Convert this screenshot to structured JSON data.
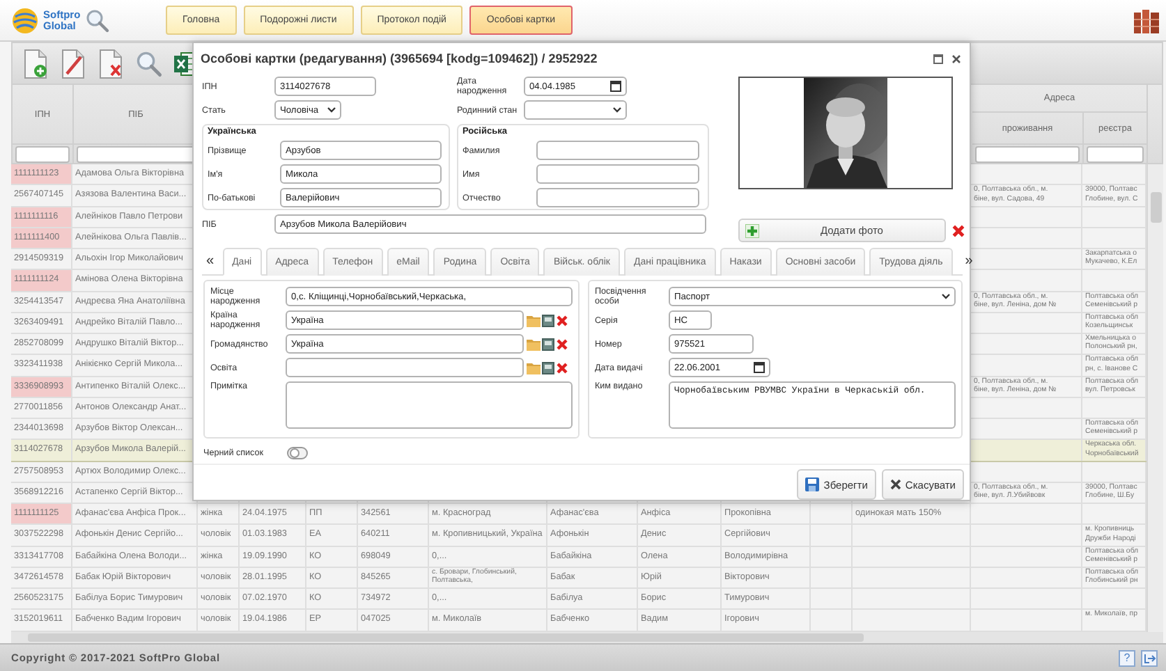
{
  "header": {
    "logo_lines": [
      "Softpro",
      "Global"
    ],
    "nav": [
      {
        "label": "Головна",
        "selected": false
      },
      {
        "label": "Подорожні листи",
        "selected": false
      },
      {
        "label": "Протокол подій",
        "selected": false
      },
      {
        "label": "Особові картки",
        "selected": true
      }
    ]
  },
  "table": {
    "group_header": "Адреса",
    "headers": {
      "ipn": "ІПН",
      "pib": "ПІБ",
      "residence": "проживання",
      "registration": "реєстра"
    },
    "rows": [
      {
        "flagged": true,
        "selected": false,
        "cells": {
          "ipn": "1111111123",
          "pib": "Адамова Ольга Вікторівна"
        }
      },
      {
        "flagged": false,
        "selected": false,
        "cells": {
          "ipn": "2567407145",
          "pib": "Азязова Валентина Васи...",
          "residence": "0, Полтавська обл., м.\nбіне, вул. Садова, 49",
          "registration": "39000, Полтавс\nГлобине, вул. С"
        }
      },
      {
        "flagged": true,
        "selected": false,
        "cells": {
          "ipn": "1111111116",
          "pib": "Алейніков Павло Петрови"
        }
      },
      {
        "flagged": true,
        "selected": false,
        "cells": {
          "ipn": "1111111400",
          "pib": "Алейнікова Ольга Павлів..."
        }
      },
      {
        "flagged": false,
        "selected": false,
        "cells": {
          "ipn": "2914509319",
          "pib": "Альохін Ігор Миколайович",
          "registration": "Закарпатська о\nМукачево, К.Ел"
        }
      },
      {
        "flagged": true,
        "selected": false,
        "cells": {
          "ipn": "1111111124",
          "pib": "Амінова Олена Вікторівна"
        }
      },
      {
        "flagged": false,
        "selected": false,
        "cells": {
          "ipn": "3254413547",
          "pib": "Андреєва Яна Анатоліївна",
          "residence": "0, Полтавська обл., м.\nбіне, вул. Леніна, дом №",
          "registration": "Полтавська обл\nСеменівський р"
        }
      },
      {
        "flagged": false,
        "selected": false,
        "cells": {
          "ipn": "3263409491",
          "pib": "Андрейко Віталій Павло...",
          "registration": "Полтавська обл\nКозельщинськ"
        }
      },
      {
        "flagged": false,
        "selected": false,
        "cells": {
          "ipn": "2852708099",
          "pib": "Андрушко Віталій Віктор...",
          "registration": "Хмельницька о\nПолонський рн,"
        }
      },
      {
        "flagged": false,
        "selected": false,
        "cells": {
          "ipn": "3323411938",
          "pib": "Анікієнко Сергій Микола...",
          "registration": "Полтавська обл\nрн, с. Іванове С"
        }
      },
      {
        "flagged": true,
        "selected": false,
        "cells": {
          "ipn": "3336908993",
          "pib": "Антипенко Віталій Олекс...",
          "residence": "0, Полтавська обл., м.\nбіне, вул. Леніна, дом №",
          "registration": "Полтавська обл\nвул. Петровськ"
        }
      },
      {
        "flagged": false,
        "selected": false,
        "cells": {
          "ipn": "2770011856",
          "pib": "Антонов Олександр Анат..."
        }
      },
      {
        "flagged": false,
        "selected": false,
        "cells": {
          "ipn": "2344013698",
          "pib": "Арзубов Віктор Олексан...",
          "registration": "Полтавська обл\nСеменівський р"
        }
      },
      {
        "flagged": false,
        "selected": true,
        "cells": {
          "ipn": "3114027678",
          "pib": "Арзубов Микола Валерій...",
          "registration": "Черкаська обл.\nЧорнобаївський"
        }
      },
      {
        "flagged": false,
        "selected": false,
        "cells": {
          "ipn": "2757508953",
          "pib": "Артюх Володимир Олекс..."
        }
      },
      {
        "flagged": false,
        "selected": false,
        "cells": {
          "ipn": "3568912216",
          "pib": "Астапенко Сергій Віктор...",
          "residence": "0, Полтавська обл., м.\nбіне, вул. Л.Убийвовк",
          "registration": "39000, Полтавс\nГлобине, Ш.Бу"
        }
      },
      {
        "flagged": true,
        "selected": false,
        "cells": {
          "ipn": "1111111125",
          "pib": "Афанас'єва Анфіса Прок...",
          "column_3": "жінка",
          "column_4": "24.04.1975",
          "column_5": "ПП",
          "column_6": "342561",
          "column_7": "м. Красноград",
          "column_8": "Афанас'єва",
          "column_9": "Анфіса",
          "column_10": "Прокопівна",
          "column_12": "одинокая мать 150%"
        }
      },
      {
        "flagged": false,
        "selected": false,
        "cells": {
          "ipn": "3037522298",
          "pib": "Афонькін Денис Сергійо...",
          "column_3": "чоловік",
          "column_4": "01.03.1983",
          "column_5": "ЕА",
          "column_6": "640211",
          "column_7": "м. Кропивницький, Україна",
          "column_8": "Афонькін",
          "column_9": "Денис",
          "column_10": "Сергійович",
          "registration": "м. Кропивниць\nДружби Народі"
        }
      },
      {
        "flagged": false,
        "selected": false,
        "cells": {
          "ipn": "3313417708",
          "pib": "Бабайкіна Олена Володи...",
          "column_3": "жінка",
          "column_4": "19.09.1990",
          "column_5": "КО",
          "column_6": "698049",
          "column_7": "0,...",
          "column_8": "Бабайкіна",
          "column_9": "Олена",
          "column_10": "Володимирівна",
          "registration": "Полтавська обл\nСеменівський р"
        }
      },
      {
        "flagged": false,
        "selected": false,
        "cells": {
          "ipn": "3472614578",
          "pib": "Бабак Юрій Вікторович",
          "column_3": "чоловік",
          "column_4": "28.01.1995",
          "column_5": "КО",
          "column_6": "845265",
          "column_7": "с. Бровари, Глобинський,\nПолтавська,",
          "column_8": "Бабак",
          "column_9": "Юрій",
          "column_10": "Вікторович",
          "registration": "Полтавська обл\nГлобинський рн"
        }
      },
      {
        "flagged": false,
        "selected": false,
        "cells": {
          "ipn": "2560523175",
          "pib": "Бабілуа Борис Тимурович",
          "column_3": "чоловік",
          "column_4": "07.02.1970",
          "column_5": "КО",
          "column_6": "734972",
          "column_7": "0,...",
          "column_8": "Бабілуа",
          "column_9": "Борис",
          "column_10": "Тимурович"
        }
      },
      {
        "flagged": false,
        "selected": false,
        "cells": {
          "ipn": "3152019611",
          "pib": "Бабченко Вадим Ігорович",
          "column_3": "чоловік",
          "column_4": "19.04.1986",
          "column_5": "ЕР",
          "column_6": "047025",
          "column_7": "м. Миколаїв",
          "column_8": "Бабченко",
          "column_9": "Вадим",
          "column_10": "Ігорович",
          "registration": "м. Миколаїв, пр"
        }
      }
    ]
  },
  "dialog": {
    "title": "Особові картки (редагування) (3965694 [kodg=109462]) / 2952922",
    "ipn": {
      "label": "ІПН",
      "value": "3114027678"
    },
    "birth_date": {
      "label": "Дата народження",
      "value": "04.04.1985"
    },
    "sex": {
      "label": "Стать",
      "value": "Чоловіча"
    },
    "marital_status": {
      "label": "Родинний стан"
    },
    "ukrainian": {
      "legend": "Українська",
      "fields": [
        {
          "label": "Прізвище",
          "value": "Арзубов"
        },
        {
          "label": "Ім'я",
          "value": "Микола"
        },
        {
          "label": "По-батькові",
          "value": "Валерійович"
        }
      ]
    },
    "russian": {
      "legend": "Російська",
      "fields": [
        {
          "label": "Фамилия"
        },
        {
          "label": "Имя"
        },
        {
          "label": "Отчество"
        }
      ]
    },
    "full_name": {
      "label": "ПІБ",
      "value": "Арзубов Микола Валерійович"
    },
    "add_photo_button": "Додати фото",
    "tabs_prev": "«",
    "tabs_next": "»",
    "tabs": [
      {
        "label": "Дані",
        "selected": true
      },
      {
        "label": "Адреса",
        "selected": false
      },
      {
        "label": "Телефон",
        "selected": false
      },
      {
        "label": "eMail",
        "selected": false
      },
      {
        "label": "Родина",
        "selected": false
      },
      {
        "label": "Освіта",
        "selected": false
      },
      {
        "label": "Військ. облік",
        "selected": false
      },
      {
        "label": "Дані працівника",
        "selected": false
      },
      {
        "label": "Накази",
        "selected": false
      },
      {
        "label": "Основні засоби",
        "selected": false
      },
      {
        "label": "Трудова діяль",
        "selected": false
      }
    ],
    "left_fields": [
      {
        "kind": "text",
        "label": "Місце народження",
        "value": "0,с. Кліщинці,Чорнобаївський,Черкаська,"
      },
      {
        "kind": "lookup",
        "label": "Країна народження",
        "value": "Україна"
      },
      {
        "kind": "lookup",
        "label": "Громадянство",
        "value": "Україна"
      },
      {
        "kind": "lookup",
        "label": "Освіта"
      },
      {
        "kind": "textarea",
        "label": "Примітка"
      }
    ],
    "right_fields": [
      {
        "kind": "select",
        "label": "Посвідчення особи",
        "value": "Паспорт"
      },
      {
        "kind": "text",
        "label": "Серія",
        "value": "НС"
      },
      {
        "kind": "text",
        "label": "Номер",
        "value": "975521"
      },
      {
        "kind": "date",
        "label": "Дата видачі",
        "value": "22.06.2001"
      },
      {
        "kind": "textarea",
        "label": "Ким видано",
        "value": "Чорнобаївським РВУМВС України в Черкаській обл."
      }
    ],
    "blacklist": {
      "label": "Черний список",
      "on": false
    },
    "buttons": [
      {
        "kind": "save",
        "label": "Зберегти"
      },
      {
        "kind": "cancel",
        "label": "Скасувати"
      }
    ]
  },
  "footer": {
    "copyright": "Copyright © 2017-2021 SoftPro Global",
    "help": "?"
  }
}
